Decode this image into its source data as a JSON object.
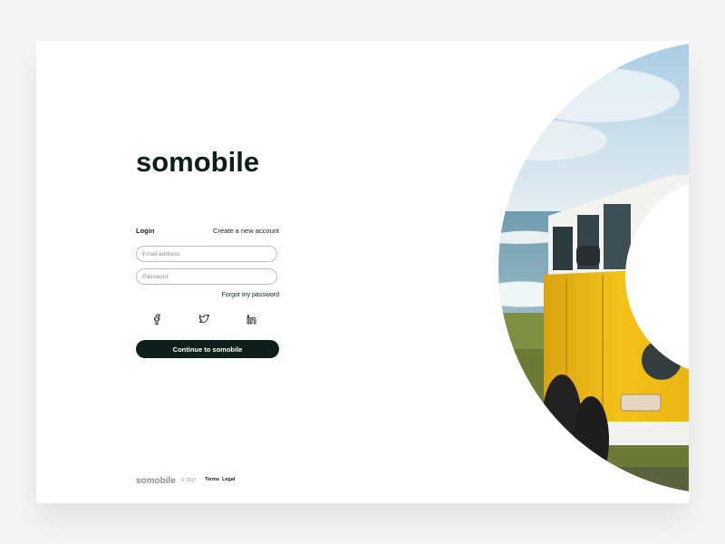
{
  "brand": {
    "logo_text": "somobile",
    "colors": {
      "primary": "#0e1e1a",
      "accent": "#f2c01e"
    }
  },
  "auth": {
    "tabs": {
      "login": "Login",
      "create": "Create a new account"
    },
    "email_placeholder": "Email address",
    "password_placeholder": "Password",
    "forgot_label": "Forgot my password",
    "social": [
      "facebook-icon",
      "twitter-icon",
      "linkedin-icon"
    ],
    "submit_label": "Continue to somobile"
  },
  "footer": {
    "logo_text": "somobile",
    "copyright": "© 2017",
    "links": [
      "Terms",
      "Legal"
    ]
  }
}
